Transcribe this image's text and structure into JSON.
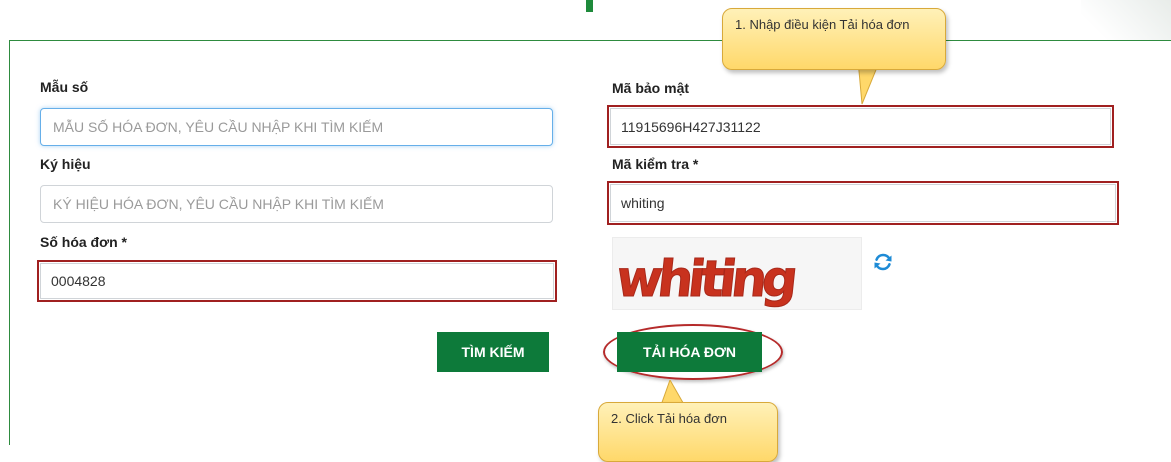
{
  "callouts": {
    "step1": "1.  Nhập điều kiện Tải hóa đơn",
    "step2": "2. Click Tải hóa đơn"
  },
  "form": {
    "mau_so": {
      "label": "Mẫu số",
      "placeholder": "MẪU SỐ HÓA ĐƠN, YÊU CẦU NHẬP KHI TÌM KIẾM"
    },
    "ky_hieu": {
      "label": "Ký hiệu",
      "placeholder": "KÝ HIỆU HÓA ĐƠN, YÊU CẦU NHẬP KHI TÌM KIẾM"
    },
    "so_hoa_don": {
      "label": "Số hóa đơn *",
      "value": "0004828"
    },
    "ma_bao_mat": {
      "label": "Mã bảo mật",
      "value": "11915696H427J31122"
    },
    "ma_kiem_tra": {
      "label": "Mã kiểm tra *",
      "value": "whiting"
    },
    "captcha_text": "whiting"
  },
  "buttons": {
    "search": "TÌM KIẾM",
    "download": "TẢI HÓA ĐƠN"
  },
  "colors": {
    "accent_green": "#0d7a3a",
    "highlight_red": "#a02020",
    "callout_yellow": "#ffd86a"
  },
  "icons": {
    "refresh": "refresh-icon"
  }
}
